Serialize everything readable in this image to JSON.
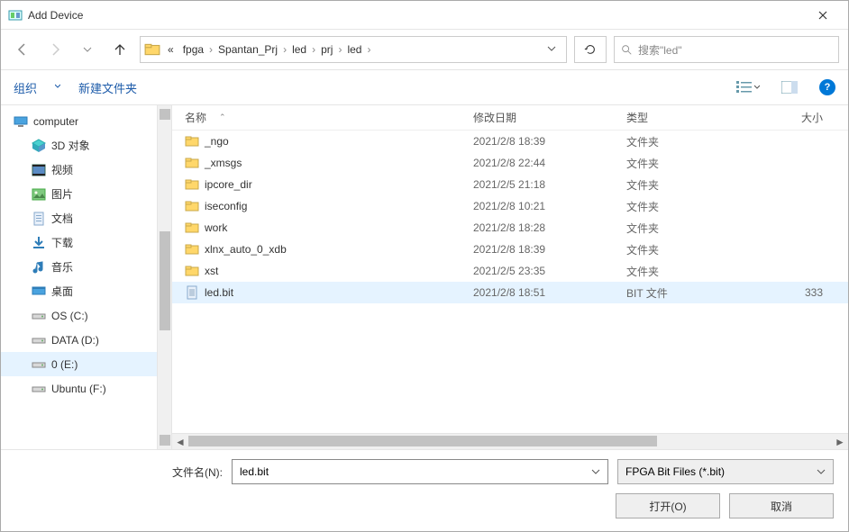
{
  "title": "Add Device",
  "breadcrumbs": [
    "fpga",
    "Spantan_Prj",
    "led",
    "prj",
    "led"
  ],
  "breadcrumb_overflow": "«",
  "search_placeholder": "搜索\"led\"",
  "toolbar": {
    "organize": "组织",
    "newfolder": "新建文件夹"
  },
  "sidebar": [
    {
      "label": "computer",
      "kind": "computer",
      "indent": "root"
    },
    {
      "label": "3D 对象",
      "kind": "3d"
    },
    {
      "label": "视频",
      "kind": "video"
    },
    {
      "label": "图片",
      "kind": "pictures"
    },
    {
      "label": "文档",
      "kind": "docs"
    },
    {
      "label": "下载",
      "kind": "downloads"
    },
    {
      "label": "音乐",
      "kind": "music"
    },
    {
      "label": "桌面",
      "kind": "desktop"
    },
    {
      "label": "OS (C:)",
      "kind": "drive"
    },
    {
      "label": "DATA (D:)",
      "kind": "drive"
    },
    {
      "label": "0 (E:)",
      "kind": "drive",
      "selected": true
    },
    {
      "label": "Ubuntu (F:)",
      "kind": "drive"
    }
  ],
  "columns": {
    "name": "名称",
    "date": "修改日期",
    "type": "类型",
    "size": "大小"
  },
  "rows": [
    {
      "name": "_ngo",
      "date": "2021/2/8 18:39",
      "type": "文件夹",
      "size": "",
      "kind": "folder"
    },
    {
      "name": "_xmsgs",
      "date": "2021/2/8 22:44",
      "type": "文件夹",
      "size": "",
      "kind": "folder"
    },
    {
      "name": "ipcore_dir",
      "date": "2021/2/5 21:18",
      "type": "文件夹",
      "size": "",
      "kind": "folder"
    },
    {
      "name": "iseconfig",
      "date": "2021/2/8 10:21",
      "type": "文件夹",
      "size": "",
      "kind": "folder"
    },
    {
      "name": "work",
      "date": "2021/2/8 18:28",
      "type": "文件夹",
      "size": "",
      "kind": "folder"
    },
    {
      "name": "xlnx_auto_0_xdb",
      "date": "2021/2/8 18:39",
      "type": "文件夹",
      "size": "",
      "kind": "folder"
    },
    {
      "name": "xst",
      "date": "2021/2/5 23:35",
      "type": "文件夹",
      "size": "",
      "kind": "folder"
    },
    {
      "name": "led.bit",
      "date": "2021/2/8 18:51",
      "type": "BIT 文件",
      "size": "333",
      "kind": "file",
      "selected": true
    }
  ],
  "filename_label": "文件名(N):",
  "filename_value": "led.bit",
  "filetype_value": "FPGA Bit Files (*.bit)",
  "buttons": {
    "open": "打开(O)",
    "cancel": "取消"
  }
}
